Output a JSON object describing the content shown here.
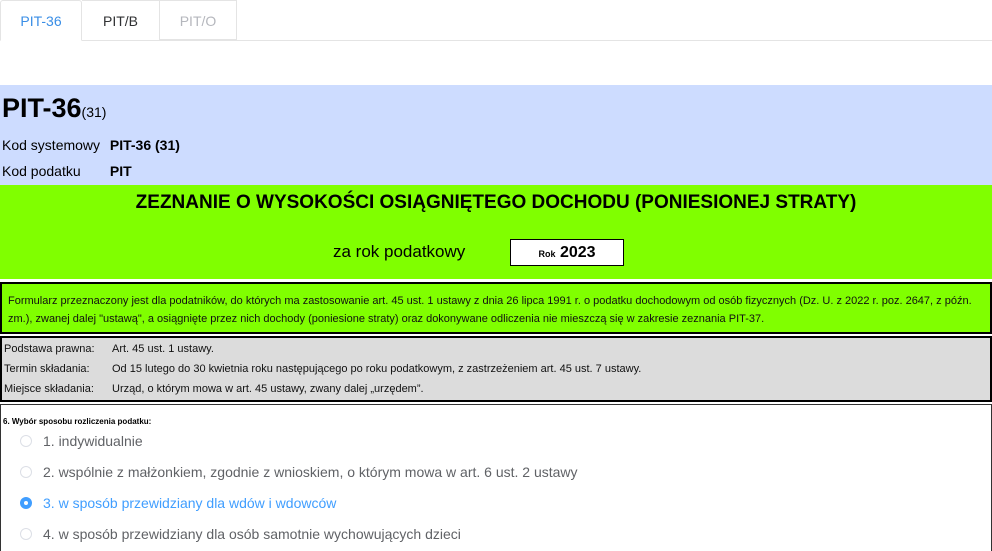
{
  "tabs": [
    {
      "label": "PIT-36"
    },
    {
      "label": "PIT/B"
    },
    {
      "label": "PIT/O"
    }
  ],
  "header": {
    "form_name": "PIT-36",
    "form_variant": "(31)",
    "kod_systemowy_label": "Kod systemowy",
    "kod_systemowy_value": "PIT-36 (31)",
    "kod_podatku_label": "Kod podatku",
    "kod_podatku_value": "PIT"
  },
  "title": "ZEZNANIE O WYSOKOŚCI OSIĄGNIĘTEGO DOCHODU (PONIESIONEJ STRATY)",
  "year": {
    "label": "za rok podatkowy",
    "field_label": "Rok",
    "value": "2023"
  },
  "info_text": "Formularz przeznaczony jest dla podatników, do których ma zastosowanie art. 45 ust. 1 ustawy z dnia 26 lipca 1991 r. o podatku dochodowym od osób fizycznych (Dz. U. z 2022 r. poz. 2647, z późn. zm.), zwanej dalej \"ustawą\", a osiągnięte przez nich dochody (poniesione straty) oraz dokonywane odliczenia nie mieszczą się w zakresie zeznania PIT-37.",
  "legal": [
    {
      "key": "Podstawa prawna:",
      "value": "Art. 45 ust. 1 ustawy."
    },
    {
      "key": "Termin składania:",
      "value": "Od 15 lutego do 30 kwietnia roku następującego po roku podatkowym, z zastrzeżeniem art. 45 ust. 7 ustawy."
    },
    {
      "key": "Miejsce składania:",
      "value": "Urząd, o którym mowa w art. 45 ustawy, zwany dalej „urzędem”."
    }
  ],
  "section6": {
    "label": "6. Wybór sposobu rozliczenia podatku:",
    "options": [
      {
        "label": "1. indywidualnie"
      },
      {
        "label": "2. wspólnie z małżonkiem, zgodnie z wnioskiem, o którym mowa w art. 6 ust. 2 ustawy"
      },
      {
        "label": "3. w sposób przewidziany dla wdów i wdowców"
      },
      {
        "label": "4. w sposób przewidziany dla osób samotnie wychowujących dzieci"
      }
    ],
    "selected": "3. w sposób przewidziany dla wdów i wdowców"
  },
  "colors": {
    "header_bg": "#cddcff",
    "green_bg": "#80ff00",
    "legal_bg": "#dcdcdc",
    "accent": "#409eff"
  }
}
